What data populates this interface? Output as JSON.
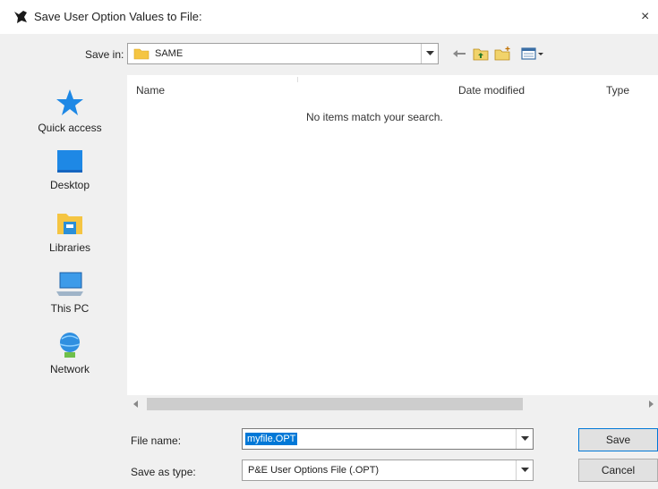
{
  "window": {
    "title": "Save User Option Values to File:",
    "close_label": "×"
  },
  "save_in": {
    "label": "Save in:",
    "value": "SAME"
  },
  "places": [
    {
      "label": "Quick access",
      "icon": "star-icon"
    },
    {
      "label": "Desktop",
      "icon": "desktop-icon"
    },
    {
      "label": "Libraries",
      "icon": "libraries-icon"
    },
    {
      "label": "This PC",
      "icon": "computer-icon"
    },
    {
      "label": "Network",
      "icon": "network-icon"
    }
  ],
  "file_list": {
    "columns": [
      "Name",
      "Date modified",
      "Type"
    ],
    "empty_message": "No items match your search."
  },
  "file_name": {
    "label": "File name:",
    "value": "myfile.OPT"
  },
  "save_as_type": {
    "label": "Save as type:",
    "value": "P&E User Options File (.OPT)"
  },
  "buttons": {
    "save": "Save",
    "cancel": "Cancel"
  },
  "colors": {
    "accent": "#0078d7",
    "folder": "#f5c542"
  }
}
